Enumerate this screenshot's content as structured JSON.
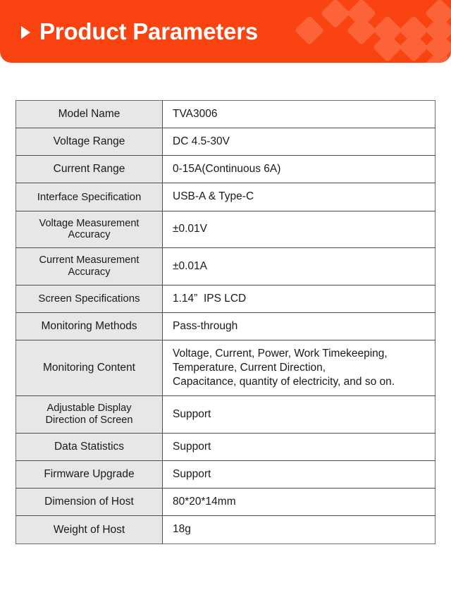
{
  "header": {
    "title": "Product Parameters",
    "arrow_icon": "play-triangle-icon",
    "background_color": "#f94411",
    "diamond_color": "#fc6338",
    "text_color": "#ffffff"
  },
  "table": {
    "label_column_background": "#e7e7e7",
    "value_column_background": "#ffffff",
    "border_color": "#4d4d4d",
    "rows": [
      {
        "label": "Model Name",
        "value_lines": [
          "TVA3006"
        ]
      },
      {
        "label": "Voltage Range",
        "value_lines": [
          "DC 4.5-30V"
        ]
      },
      {
        "label": "Current Range",
        "value_lines": [
          "0-15A(Continuous 6A)"
        ]
      },
      {
        "label": "Interface Specification",
        "value_lines": [
          "USB-A & Type-C"
        ]
      },
      {
        "label": "Voltage Measurement Accuracy",
        "label_lines": [
          "Voltage Measurement",
          "Accuracy"
        ],
        "value_lines": [
          "±0.01V"
        ]
      },
      {
        "label": "Current Measurement Accuracy",
        "label_lines": [
          "Current Measurement",
          "Accuracy"
        ],
        "value_lines": [
          "±0.01A"
        ]
      },
      {
        "label": "Screen Specifications",
        "value_lines": [
          "1.14”  IPS LCD"
        ]
      },
      {
        "label": "Monitoring Methods",
        "value_lines": [
          "Pass-through"
        ]
      },
      {
        "label": "Monitoring Content",
        "value_lines": [
          "Voltage, Current, Power, Work Timekeeping,",
          "Temperature, Current Direction,",
          "Capacitance, quantity of electricity, and so on."
        ]
      },
      {
        "label": "Adjustable Display Direction of Screen",
        "label_lines": [
          "Adjustable Display",
          "Direction of Screen"
        ],
        "value_lines": [
          "Support"
        ]
      },
      {
        "label": "Data Statistics",
        "value_lines": [
          "Support"
        ]
      },
      {
        "label": "Firmware Upgrade",
        "value_lines": [
          "Support"
        ]
      },
      {
        "label": "Dimension of Host",
        "value_lines": [
          "80*20*14mm"
        ]
      },
      {
        "label": "Weight of Host",
        "value_lines": [
          "18g"
        ]
      }
    ]
  }
}
